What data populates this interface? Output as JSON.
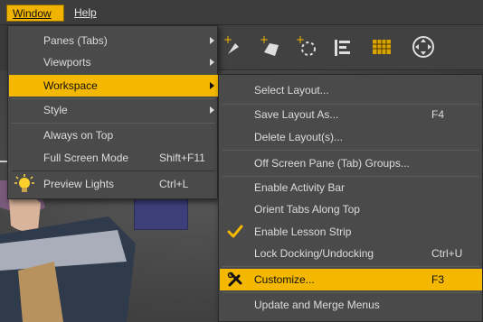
{
  "menubar": {
    "window_label": "Window",
    "help_label": "Help"
  },
  "window_menu": {
    "items": [
      {
        "label": "Panes (Tabs)",
        "shortcut": "",
        "submenu": true
      },
      {
        "label": "Viewports",
        "shortcut": "",
        "submenu": true
      },
      {
        "label": "Workspace",
        "shortcut": "",
        "submenu": true,
        "highlighted": true
      },
      {
        "label": "Style",
        "shortcut": "",
        "submenu": true
      },
      {
        "label": "Always on Top",
        "shortcut": ""
      },
      {
        "label": "Full Screen Mode",
        "shortcut": "Shift+F11"
      },
      {
        "label": "Preview Lights",
        "shortcut": "Ctrl+L",
        "icon": "light-bulb-icon"
      }
    ]
  },
  "workspace_submenu": {
    "items": [
      {
        "label": "Select Layout...",
        "shortcut": ""
      },
      {
        "label": "Save Layout As...",
        "shortcut": "F4"
      },
      {
        "label": "Delete Layout(s)...",
        "shortcut": ""
      },
      {
        "label": "Off Screen Pane (Tab) Groups...",
        "shortcut": ""
      },
      {
        "label": "Enable Activity Bar",
        "shortcut": ""
      },
      {
        "label": "Orient Tabs Along Top",
        "shortcut": ""
      },
      {
        "label": "Enable Lesson Strip",
        "shortcut": "",
        "checked": true
      },
      {
        "label": "Lock Docking/Undocking",
        "shortcut": "Ctrl+U"
      },
      {
        "label": "Customize...",
        "shortcut": "F3",
        "highlighted": true,
        "icon": "wrench-screwdriver-icon"
      },
      {
        "label": "Update and Merge Menus",
        "shortcut": ""
      }
    ]
  },
  "colors": {
    "accent": "#f5b800",
    "menu_bg": "#4a4a4a",
    "menu_text": "#dcdcdc"
  }
}
